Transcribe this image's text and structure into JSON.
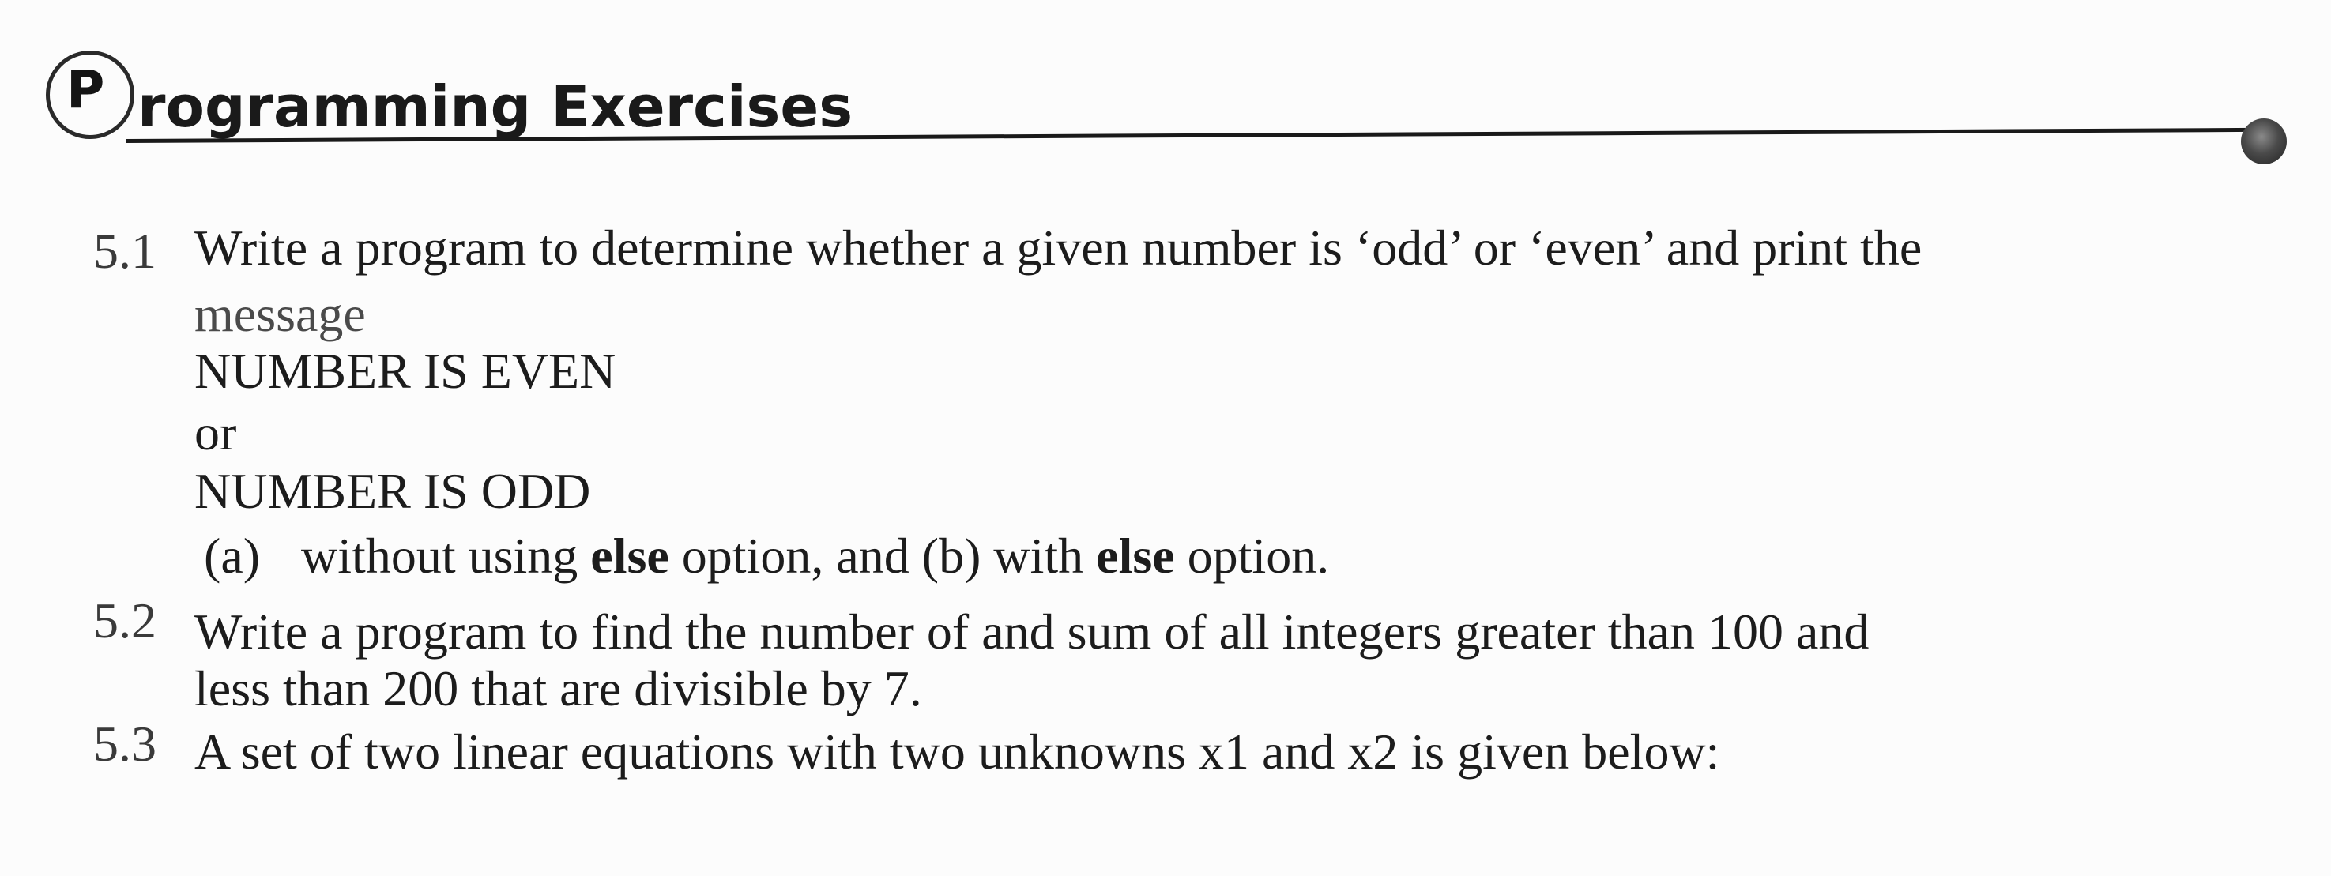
{
  "header": {
    "initial": "P",
    "title": "rogramming Exercises"
  },
  "exercises": [
    {
      "number": "5.1",
      "line1": "Write a program to determine whether a given number is ‘odd’ or ‘even’ and print the",
      "line2": "message",
      "out1": "NUMBER IS EVEN",
      "or": "or",
      "out2": "NUMBER IS ODD",
      "options_prefix": "(a)",
      "options_text_1": "without using ",
      "options_kw_1": "else",
      "options_text_2": " option, and (b) with ",
      "options_kw_2": "else",
      "options_text_3": " option."
    },
    {
      "number": "5.2",
      "line1": "Write a program to find the number of and sum of all integers greater than 100 and",
      "line2": "less than 200 that are divisible by 7."
    },
    {
      "number": "5.3",
      "line1": "A set of two linear equations with two unknowns x1 and x2 is given below:"
    }
  ]
}
